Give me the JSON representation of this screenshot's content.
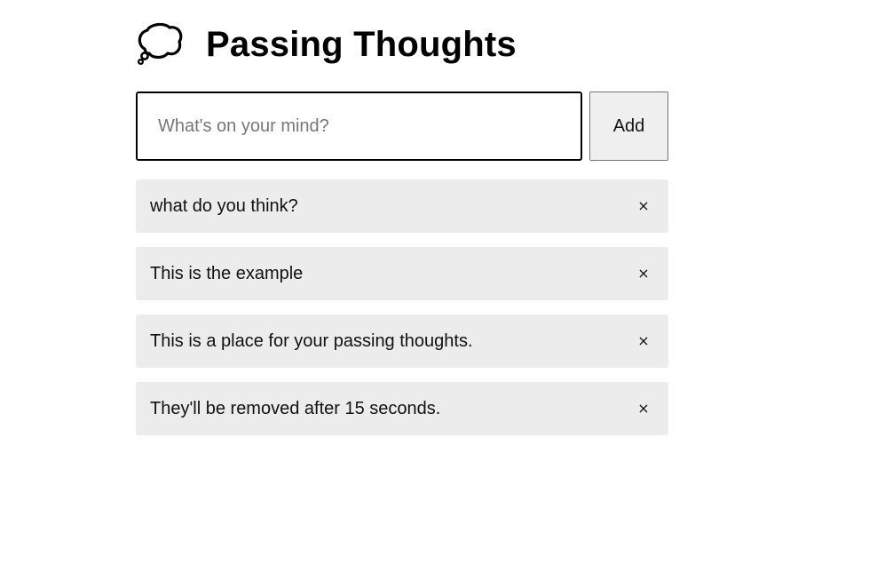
{
  "header": {
    "icon": "thought-balloon-icon",
    "title": "Passing Thoughts"
  },
  "form": {
    "input_value": "",
    "input_placeholder": "What's on your mind?",
    "add_label": "Add"
  },
  "thoughts": [
    {
      "text": "what do you think?",
      "remove_label": "×"
    },
    {
      "text": "This is the example",
      "remove_label": "×"
    },
    {
      "text": "This is a place for your passing thoughts.",
      "remove_label": "×"
    },
    {
      "text": "They'll be removed after 15 seconds.",
      "remove_label": "×"
    }
  ],
  "colors": {
    "item_background": "#ececec",
    "input_border": "#000000",
    "button_background": "#efefef"
  }
}
